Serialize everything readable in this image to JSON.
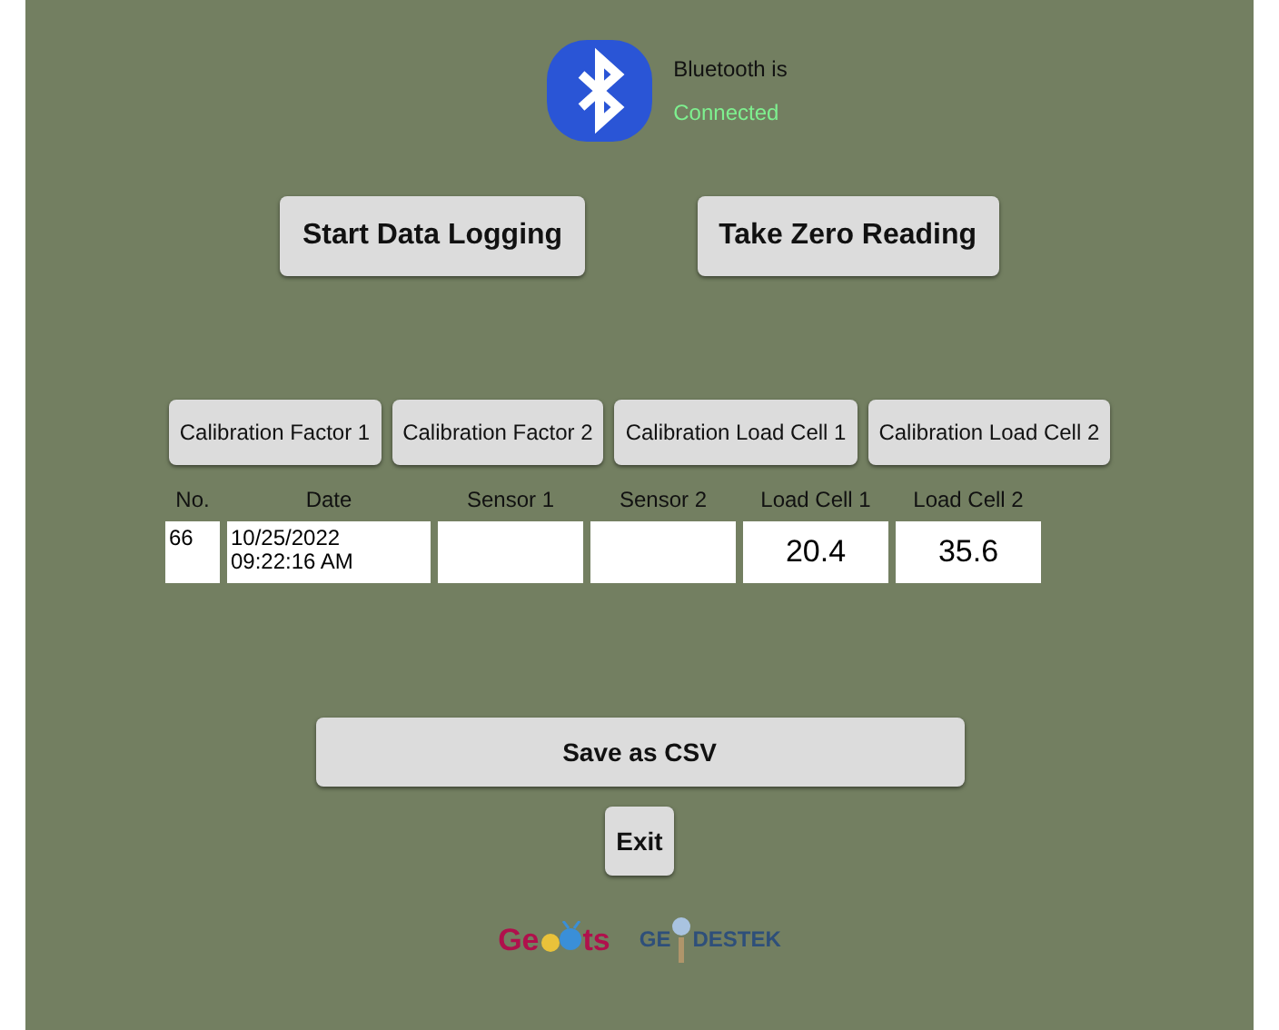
{
  "status": {
    "label": "Bluetooth is",
    "value": "Connected"
  },
  "actions": [
    "Start Data Logging",
    "Take Zero Reading"
  ],
  "calibration_buttons": [
    "Calibration Factor 1",
    "Calibration Factor 2",
    "Calibration Load Cell 1",
    "Calibration Load Cell 2"
  ],
  "table": {
    "columns": [
      {
        "header": "No.",
        "value": "66"
      },
      {
        "header": "Date",
        "value": "10/25/2022\n09:22:16 AM"
      },
      {
        "header": "Sensor 1"
      },
      {
        "header": "Sensor 2"
      },
      {
        "header": "Load Cell 1",
        "value": "20.4"
      },
      {
        "header": "Load Cell 2",
        "value": "35.6"
      }
    ]
  },
  "save_button": "Save as CSV",
  "exit_button": "Exit",
  "logos": {
    "left": [
      "Ge",
      "ts"
    ],
    "right": [
      "GE",
      "DESTEK"
    ]
  }
}
